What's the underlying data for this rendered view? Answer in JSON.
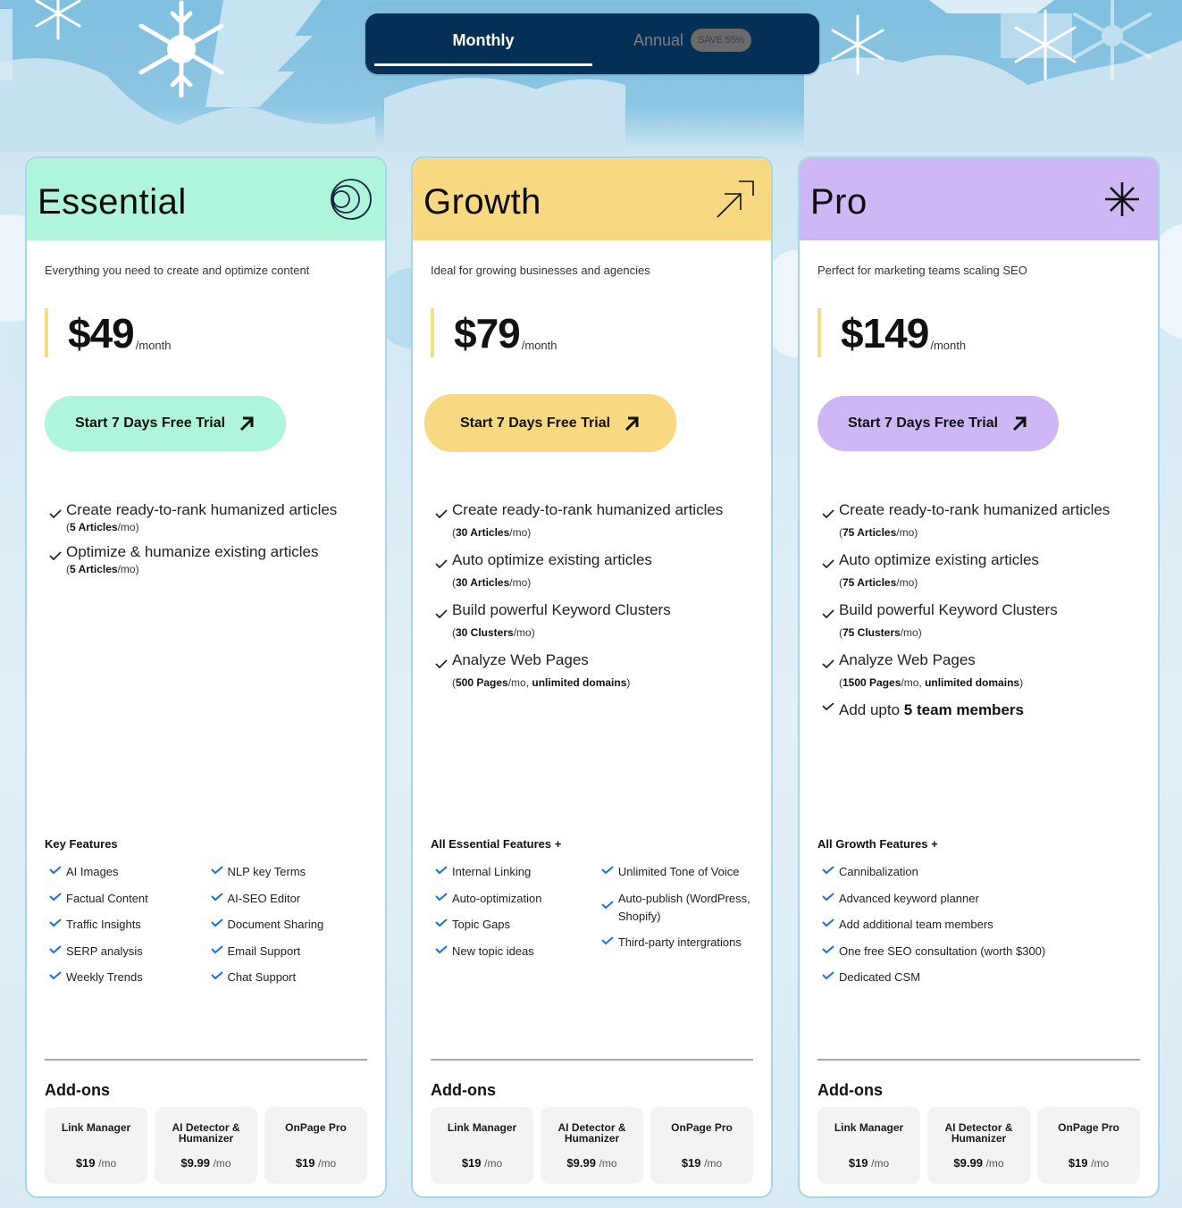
{
  "billing_toggle": {
    "monthly_label": "Monthly",
    "annual_label": "Annual",
    "save_badge": "SAVE 55%",
    "selected": "Monthly"
  },
  "colors": {
    "essential": "#aef5dc",
    "growth": "#f8d981",
    "pro": "#cdb8f5",
    "check_blue": "#1a6fe0",
    "toggle_bg": "#053055"
  },
  "plans": [
    {
      "name": "Essential",
      "icon": "concentric-circles-icon",
      "tagline": "Everything you need to create and optimize content",
      "price": "$49",
      "period": "/month",
      "cta_label": "Start 7 Days Free Trial",
      "main_features": [
        {
          "title": "Create ready-to-rank humanized articles",
          "qty": "5 Articles",
          "unit": "/mo",
          "extra": ""
        },
        {
          "title": "Optimize & humanize existing articles",
          "qty": "5 Articles",
          "unit": "/mo",
          "extra": ""
        }
      ],
      "key_features_heading": "Key Features",
      "key_features_col1": [
        "AI Images",
        "Factual Content",
        "Traffic Insights",
        "SERP analysis",
        "Weekly Trends"
      ],
      "key_features_col2": [
        "NLP key Terms",
        "AI-SEO Editor",
        "Document Sharing",
        "Email Support",
        "Chat Support"
      ],
      "addons_title": "Add-ons",
      "addons": [
        {
          "name": "Link Manager",
          "price": "$19",
          "unit": "/mo"
        },
        {
          "name": "AI Detector & Humanizer",
          "price": "$9.99",
          "unit": "/mo"
        },
        {
          "name": "OnPage Pro",
          "price": "$19",
          "unit": "/mo"
        }
      ]
    },
    {
      "name": "Growth",
      "icon": "arrow-up-right-icon",
      "tagline": "Ideal for growing businesses and agencies",
      "price": "$79",
      "period": "/month",
      "cta_label": "Start 7 Days Free Trial",
      "main_features": [
        {
          "title": "Create ready-to-rank humanized articles",
          "qty": "30 Articles",
          "unit": "/mo",
          "extra": ""
        },
        {
          "title": "Auto optimize existing articles",
          "qty": "30 Articles",
          "unit": "/mo",
          "extra": ""
        },
        {
          "title": "Build powerful Keyword Clusters",
          "qty": "30 Clusters",
          "unit": "/mo",
          "extra": ""
        },
        {
          "title": "Analyze Web Pages",
          "qty": "500 Pages",
          "unit": "/mo, ",
          "extra": "unlimited domains"
        }
      ],
      "key_features_heading": "All Essential Features +",
      "key_features_col1": [
        "Internal Linking",
        "Auto-optimization",
        "Topic Gaps",
        "New topic ideas"
      ],
      "key_features_col2": [
        "Unlimited Tone of Voice",
        "Auto-publish (WordPress, Shopify)",
        "Third-party intergrations"
      ],
      "addons_title": "Add-ons",
      "addons": [
        {
          "name": "Link Manager",
          "price": "$19",
          "unit": "/mo"
        },
        {
          "name": "AI Detector & Humanizer",
          "price": "$9.99",
          "unit": "/mo"
        },
        {
          "name": "OnPage Pro",
          "price": "$19",
          "unit": "/mo"
        }
      ]
    },
    {
      "name": "Pro",
      "icon": "asterisk-icon",
      "tagline": "Perfect for marketing teams scaling SEO",
      "price": "$149",
      "period": "/month",
      "cta_label": "Start 7 Days Free Trial",
      "main_features": [
        {
          "title": "Create ready-to-rank humanized articles",
          "qty": "75 Articles",
          "unit": "/mo",
          "extra": ""
        },
        {
          "title": "Auto optimize existing articles",
          "qty": "75 Articles",
          "unit": "/mo",
          "extra": ""
        },
        {
          "title": "Build powerful Keyword Clusters",
          "qty": "75 Clusters",
          "unit": "/mo",
          "extra": ""
        },
        {
          "title": "Analyze Web Pages",
          "qty": "1500 Pages",
          "unit": "/mo, ",
          "extra": "unlimited domains"
        }
      ],
      "team_feature": {
        "prefix": "Add upto ",
        "bold": "5 team members"
      },
      "key_features_heading": "All Growth Features +",
      "key_features_col1": [
        "Cannibalization",
        "Advanced keyword planner",
        "Add additional team members",
        "One free SEO consultation (worth $300)",
        "Dedicated CSM"
      ],
      "key_features_col2": [],
      "addons_title": "Add-ons",
      "addons": [
        {
          "name": "Link Manager",
          "price": "$19",
          "unit": "/mo"
        },
        {
          "name": "AI Detector & Humanizer",
          "price": "$9.99",
          "unit": "/mo"
        },
        {
          "name": "OnPage Pro",
          "price": "$19",
          "unit": "/mo"
        }
      ]
    }
  ]
}
